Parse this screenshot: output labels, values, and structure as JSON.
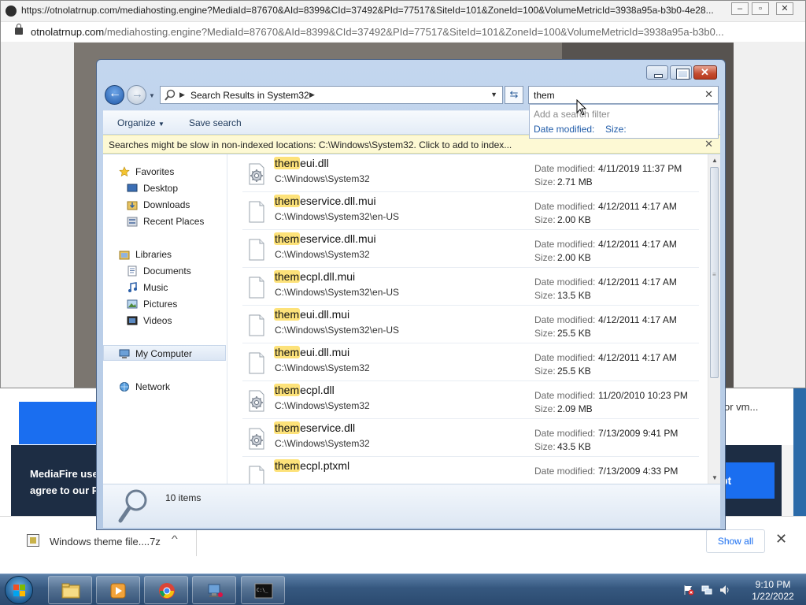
{
  "browser_popup": {
    "title": "https://otnolatrnup.com/mediahosting.engine?MediaId=87670&AId=8399&CId=37492&PId=77517&SiteId=101&ZoneId=100&VolumeMetricId=3938a95a-b3b0-4e28...",
    "url_host": "otnolatrnup.com",
    "url_path": "/mediahosting.engine?MediaId=87670&AId=8399&CId=37492&PId=77517&SiteId=101&ZoneId=100&VolumeMetricId=3938a95a-b3b0..."
  },
  "background_page": {
    "vm_text": "or vm...",
    "cookie_text_1": "MediaFire use",
    "cookie_text_2": "agree to our P",
    "accept_label": "pt"
  },
  "explorer": {
    "breadcrumb": "Search Results in System32",
    "search_value": "them",
    "filter_title": "Add a search filter",
    "filter_date": "Date modified:",
    "filter_size": "Size:",
    "organize_label": "Organize",
    "save_search_label": "Save search",
    "info_message": "Searches might be slow in non-indexed locations: C:\\Windows\\System32. Click to add to index...",
    "nav": {
      "favorites": "Favorites",
      "desktop": "Desktop",
      "downloads": "Downloads",
      "recent": "Recent Places",
      "libraries": "Libraries",
      "documents": "Documents",
      "music": "Music",
      "pictures": "Pictures",
      "videos": "Videos",
      "computer": "My Computer",
      "network": "Network"
    },
    "date_label": "Date modified:",
    "size_label": "Size:",
    "files": [
      {
        "match": "them",
        "rest": "eui.dll",
        "path": "C:\\Windows\\System32",
        "date": "4/11/2019 11:37 PM",
        "size": "2.71 MB",
        "icon": "dll-gear-icon"
      },
      {
        "match": "them",
        "rest": "eservice.dll.mui",
        "path": "C:\\Windows\\System32\\en-US",
        "date": "4/12/2011 4:17 AM",
        "size": "2.00 KB",
        "icon": "file-icon"
      },
      {
        "match": "them",
        "rest": "eservice.dll.mui",
        "path": "C:\\Windows\\System32",
        "date": "4/12/2011 4:17 AM",
        "size": "2.00 KB",
        "icon": "file-icon"
      },
      {
        "match": "them",
        "rest": "ecpl.dll.mui",
        "path": "C:\\Windows\\System32\\en-US",
        "date": "4/12/2011 4:17 AM",
        "size": "13.5 KB",
        "icon": "file-icon"
      },
      {
        "match": "them",
        "rest": "eui.dll.mui",
        "path": "C:\\Windows\\System32\\en-US",
        "date": "4/12/2011 4:17 AM",
        "size": "25.5 KB",
        "icon": "file-icon"
      },
      {
        "match": "them",
        "rest": "eui.dll.mui",
        "path": "C:\\Windows\\System32",
        "date": "4/12/2011 4:17 AM",
        "size": "25.5 KB",
        "icon": "file-icon"
      },
      {
        "match": "them",
        "rest": "ecpl.dll",
        "path": "C:\\Windows\\System32",
        "date": "11/20/2010 10:23 PM",
        "size": "2.09 MB",
        "icon": "dll-gear-icon"
      },
      {
        "match": "them",
        "rest": "eservice.dll",
        "path": "C:\\Windows\\System32",
        "date": "7/13/2009 9:41 PM",
        "size": "43.5 KB",
        "icon": "dll-gear-icon"
      },
      {
        "match": "them",
        "rest": "ecpl.ptxml",
        "path": "",
        "date": "7/13/2009 4:33 PM",
        "size": "",
        "icon": "file-icon"
      }
    ],
    "item_count": "10 items"
  },
  "download_bar": {
    "file_name": "Windows theme file....7z",
    "show_all_label": "Show all"
  },
  "taskbar": {
    "time": "9:10 PM",
    "date": "1/22/2022"
  },
  "colors": {
    "highlight": "#fde27a",
    "link_blue": "#1f5ba8",
    "chrome_blue": "#1a6ef0"
  }
}
